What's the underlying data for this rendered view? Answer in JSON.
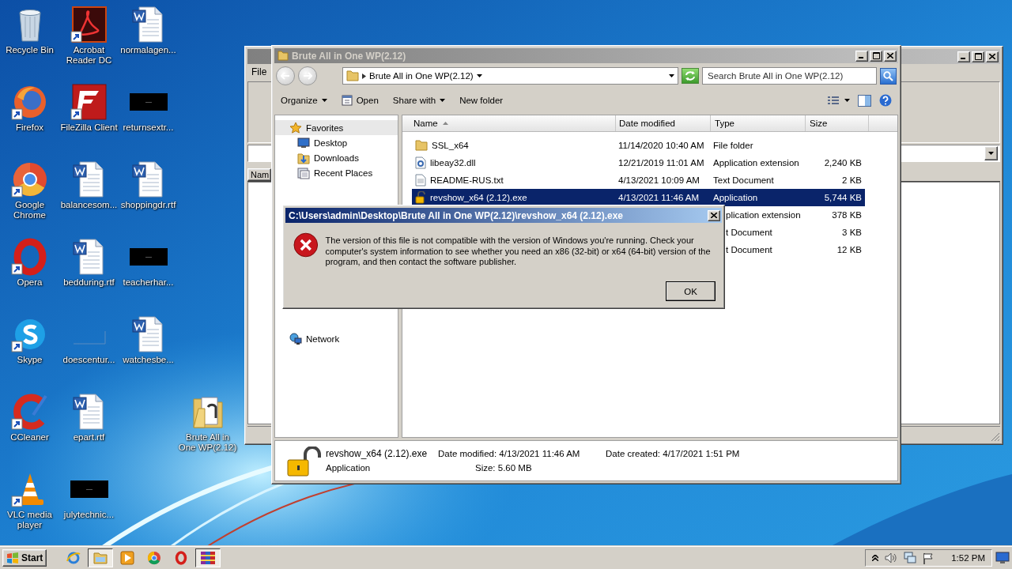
{
  "desktop": {
    "columns": [
      [
        {
          "label": "Recycle Bin",
          "kind": "recycle",
          "shortcut": false
        },
        {
          "label": "Firefox",
          "kind": "firefox",
          "shortcut": true
        },
        {
          "label": "Google Chrome",
          "kind": "chrome",
          "shortcut": true
        },
        {
          "label": "Opera",
          "kind": "opera",
          "shortcut": true
        },
        {
          "label": "Skype",
          "kind": "skype",
          "shortcut": true
        },
        {
          "label": "CCleaner",
          "kind": "ccleaner",
          "shortcut": true
        },
        {
          "label": "VLC media player",
          "kind": "vlc",
          "shortcut": true
        }
      ],
      [
        {
          "label": "Acrobat Reader DC",
          "kind": "acrobat",
          "shortcut": true
        },
        {
          "label": "FileZilla Client",
          "kind": "filezilla",
          "shortcut": true
        },
        {
          "label": "balancesom...",
          "kind": "word",
          "shortcut": false
        },
        {
          "label": "bedduring.rtf",
          "kind": "word",
          "shortcut": false
        },
        {
          "label": "doescentur...",
          "kind": "blank",
          "shortcut": false
        },
        {
          "label": "epart.rtf",
          "kind": "word",
          "shortcut": false
        },
        {
          "label": "julytechnic...",
          "kind": "redacted",
          "shortcut": false
        }
      ],
      [
        {
          "label": "normalagen...",
          "kind": "word",
          "shortcut": false
        },
        {
          "label": "returnsextr...",
          "kind": "redacted",
          "shortcut": false
        },
        {
          "label": "shoppingdr.rtf",
          "kind": "word",
          "shortcut": false
        },
        {
          "label": "teacherhar...",
          "kind": "redacted",
          "shortcut": false
        },
        {
          "label": "watchesbe...",
          "kind": "word",
          "shortcut": false
        }
      ],
      [
        {
          "label": "Brute All in One WP(2.12)",
          "kind": "folder",
          "shortcut": false
        }
      ]
    ]
  },
  "back_window": {
    "menu": [
      "File"
    ],
    "list_header": "Nam"
  },
  "explorer": {
    "title": "Brute All in One WP(2.12)",
    "address": "Brute All in One WP(2.12)",
    "search": {
      "placeholder": "Search Brute All in One WP(2.12)"
    },
    "toolbar": [
      {
        "label": "Organize",
        "kind": "menu"
      },
      {
        "label": "Open",
        "kind": "open"
      },
      {
        "label": "Share with",
        "kind": "menu"
      },
      {
        "label": "New folder",
        "kind": "plain"
      }
    ],
    "nav": [
      {
        "label": "Favorites",
        "kind": "favorites",
        "selected": true
      },
      {
        "label": "Desktop",
        "kind": "desktop",
        "selected": false
      },
      {
        "label": "Downloads",
        "kind": "downloads",
        "selected": false
      },
      {
        "label": "Recent Places",
        "kind": "recent",
        "selected": false
      },
      {
        "label": "Network",
        "kind": "network",
        "selected": false
      }
    ],
    "columns": [
      {
        "label": "Name",
        "sorted": true
      },
      {
        "label": "Date modified",
        "sorted": false
      },
      {
        "label": "Type",
        "sorted": false
      },
      {
        "label": "Size",
        "sorted": false
      }
    ],
    "rows": [
      {
        "name": "SSL_x64",
        "date": "11/14/2020 10:40 AM",
        "type": "File folder",
        "kind": "folder",
        "selected": false
      },
      {
        "name": "libeay32.dll",
        "date": "12/21/2019 11:01 AM",
        "type": "Application extension",
        "size": "2,240 KB",
        "kind": "dll",
        "selected": false
      },
      {
        "name": "README-RUS.txt",
        "date": "4/13/2021 10:09 AM",
        "type": "Text Document",
        "size": "2 KB",
        "kind": "txt",
        "selected": false
      },
      {
        "name": "revshow_x64 (2.12).exe",
        "date": "4/13/2021 11:46 AM",
        "type": "Application",
        "size": "5,744 KB",
        "kind": "exe",
        "selected": true
      },
      {
        "type": "plication extension",
        "size": "378 KB",
        "selected": false
      },
      {
        "type": "t Document",
        "size": "3 KB",
        "selected": false
      },
      {
        "type": "t Document",
        "size": "12 KB",
        "selected": false
      }
    ],
    "details": {
      "name": "revshow_x64 (2.12).exe",
      "type": "Application",
      "modified": "Date modified: 4/13/2021 11:46 AM",
      "created": "Date created: 4/17/2021 1:51 PM",
      "size": "Size: 5.60 MB"
    }
  },
  "dialog": {
    "title": "C:\\Users\\admin\\Desktop\\Brute All in One WP(2.12)\\revshow_x64 (2.12).exe",
    "message": "The version of this file is not compatible with the version of Windows you're running. Check your computer's system information to see whether you need an x86 (32-bit) or x64 (64-bit) version of the program, and then contact the software publisher.",
    "button": "OK"
  },
  "taskbar": {
    "start": "Start",
    "apps": [
      {
        "kind": "ie",
        "selected": false
      },
      {
        "kind": "explorer",
        "selected": true
      },
      {
        "kind": "media",
        "selected": false
      },
      {
        "kind": "chrome",
        "selected": false
      },
      {
        "kind": "opera",
        "selected": false
      },
      {
        "kind": "winrar",
        "selected": true
      }
    ],
    "clock": "1:52 PM"
  }
}
